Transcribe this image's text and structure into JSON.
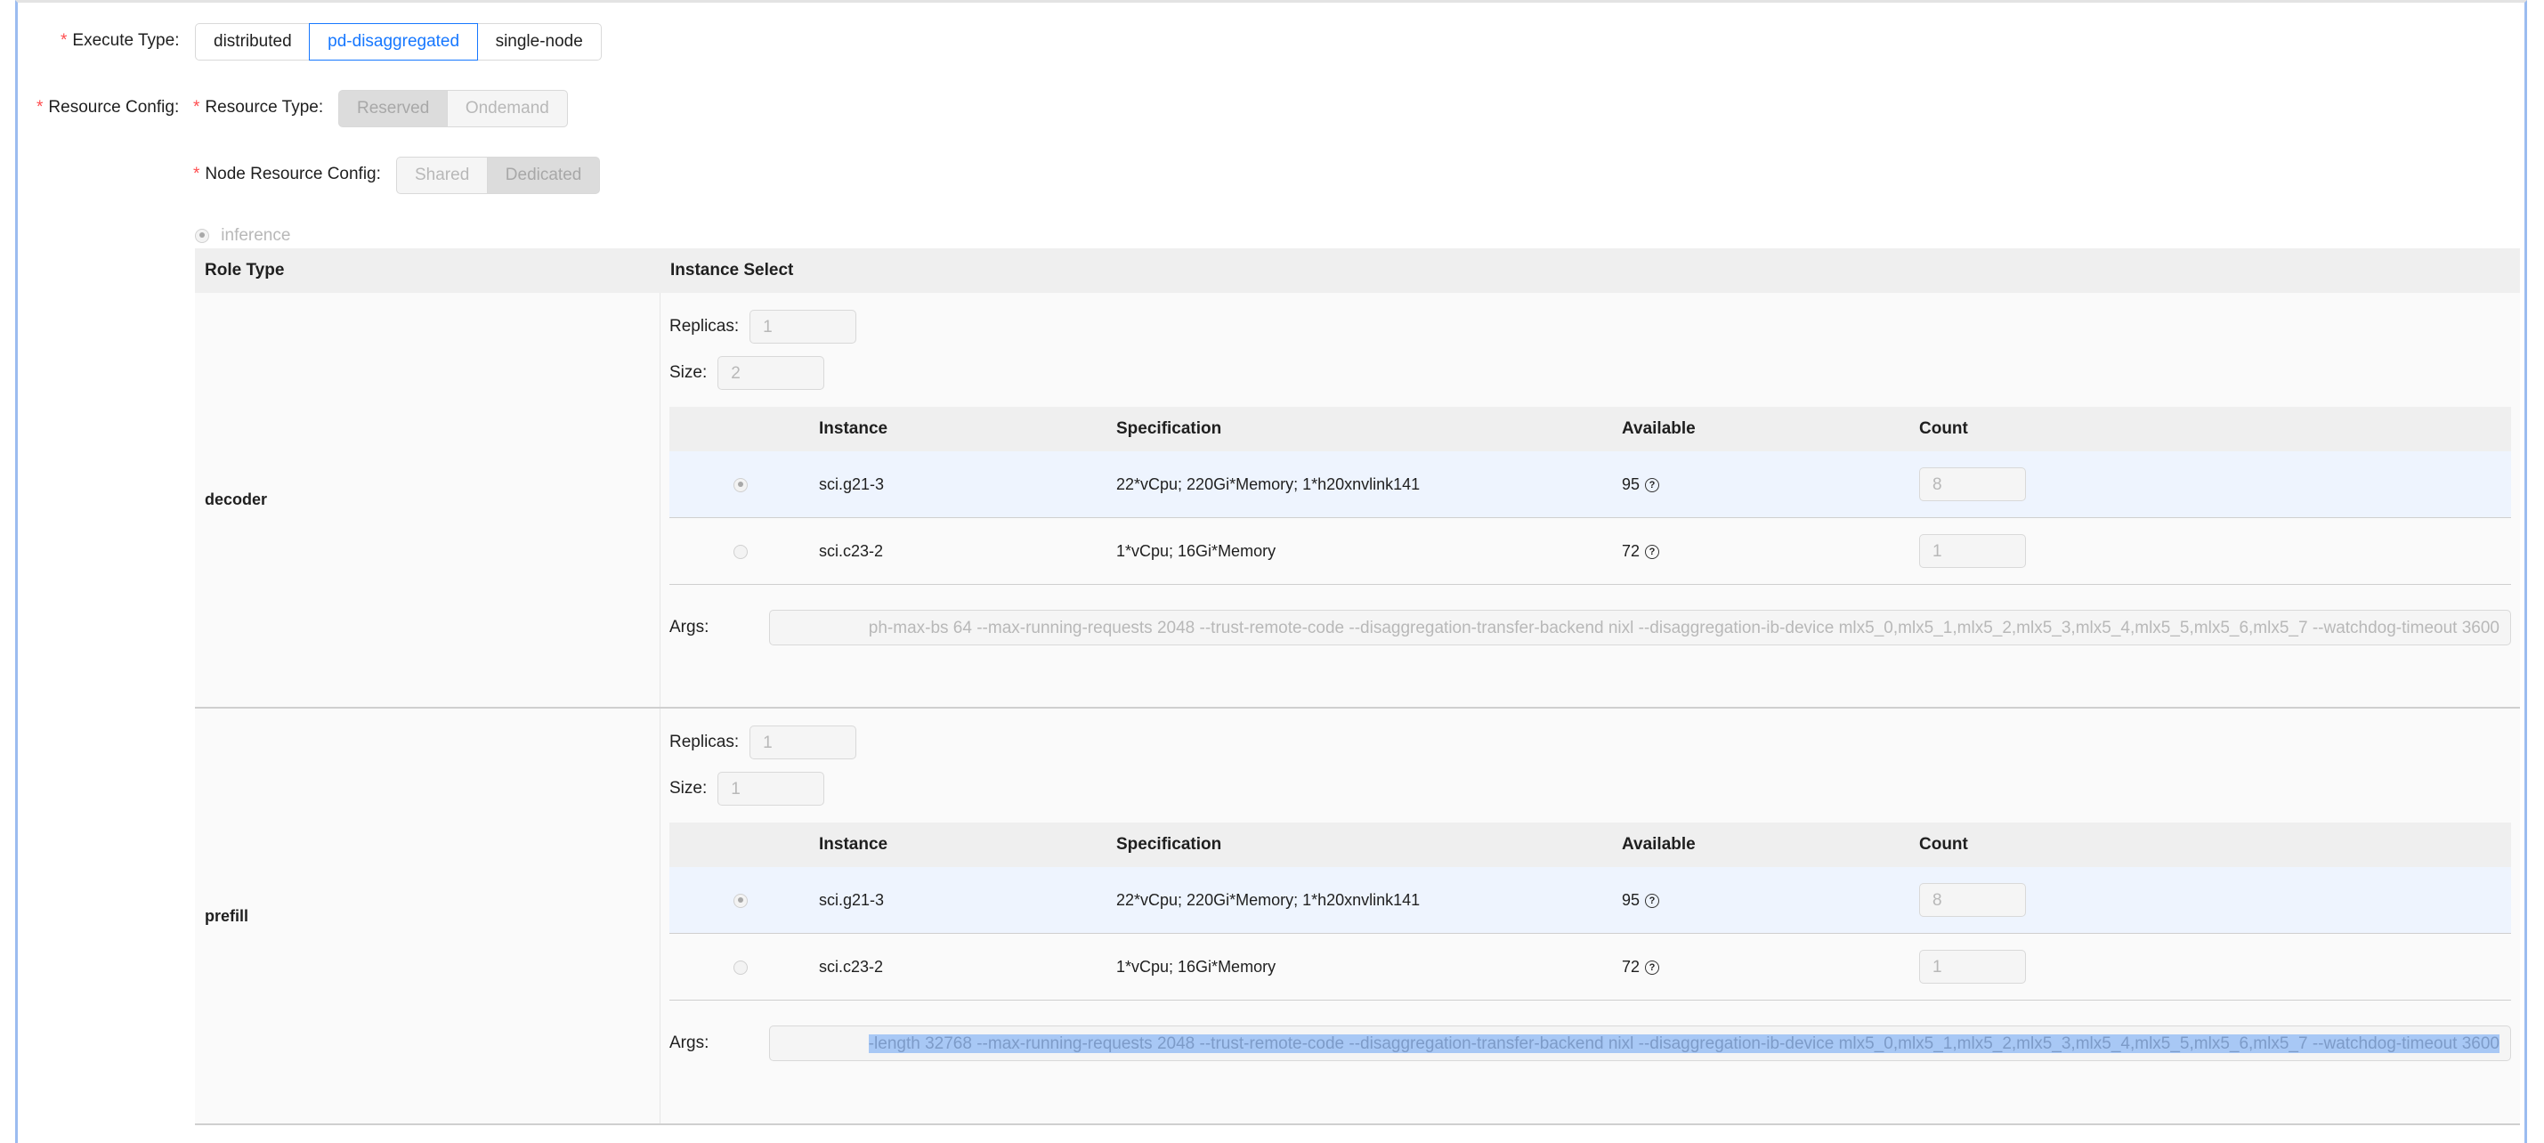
{
  "execute_type": {
    "label": "Execute Type",
    "options": [
      "distributed",
      "pd-disaggregated",
      "single-node"
    ],
    "selected": "pd-disaggregated"
  },
  "resource_config": {
    "label": "Resource Config",
    "resource_type": {
      "label": "Resource Type",
      "options": [
        "Reserved",
        "Ondemand"
      ],
      "selected": "Reserved"
    },
    "node_resource_config": {
      "label": "Node Resource Config",
      "options": [
        "Shared",
        "Dedicated"
      ],
      "selected": "Dedicated"
    }
  },
  "inference_radio": "inference",
  "table": {
    "headers": {
      "role_type": "Role Type",
      "instance_select": "Instance Select"
    },
    "instance_headers": {
      "instance": "Instance",
      "specification": "Specification",
      "available": "Available",
      "count": "Count"
    },
    "replicas_label": "Replicas:",
    "size_label": "Size:",
    "args_label": "Args:",
    "roles": [
      {
        "name": "decoder",
        "replicas": "1",
        "size": "2",
        "instances": [
          {
            "instance": "sci.g21-3",
            "spec": "22*vCpu; 220Gi*Memory; 1*h20xnvlink141",
            "available": "95",
            "count": "8",
            "selected": true
          },
          {
            "instance": "sci.c23-2",
            "spec": "1*vCpu; 16Gi*Memory",
            "available": "72",
            "count": "1",
            "selected": false
          }
        ],
        "args": "ph-max-bs 64 --max-running-requests 2048 --trust-remote-code --disaggregation-transfer-backend nixl --disaggregation-ib-device mlx5_0,mlx5_1,mlx5_2,mlx5_3,mlx5_4,mlx5_5,mlx5_6,mlx5_7  --watchdog-timeout 3600"
      },
      {
        "name": "prefill",
        "replicas": "1",
        "size": "1",
        "instances": [
          {
            "instance": "sci.g21-3",
            "spec": "22*vCpu; 220Gi*Memory; 1*h20xnvlink141",
            "available": "95",
            "count": "8",
            "selected": true
          },
          {
            "instance": "sci.c23-2",
            "spec": "1*vCpu; 16Gi*Memory",
            "available": "72",
            "count": "1",
            "selected": false
          }
        ],
        "args": "-length 32768 --max-running-requests 2048 --trust-remote-code --disaggregation-transfer-backend nixl --disaggregation-ib-device mlx5_0,mlx5_1,mlx5_2,mlx5_3,mlx5_4,mlx5_5,mlx5_6,mlx5_7 --watchdog-timeout 3600"
      }
    ]
  }
}
